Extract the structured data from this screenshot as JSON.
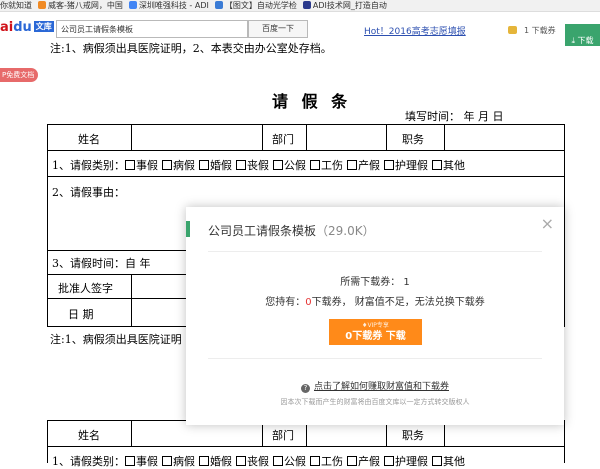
{
  "bookmarks": [
    {
      "label": "你就知道",
      "color": ""
    },
    {
      "label": "威客-猪八戒网，中国",
      "color": "#f08a24"
    },
    {
      "label": "深圳唯强科技 - ADI",
      "color": "#4285f4"
    },
    {
      "label": "【图文】自动光学检",
      "color": "#3a7bd5"
    },
    {
      "label": "ADI技术网_打造自动",
      "color": "#2b3a8c"
    }
  ],
  "toolbar": {
    "logo_main": "ai",
    "logo_paw": "du",
    "logo_badge": "文库",
    "search_value": "公司员工请假条模板",
    "search_button": "百度一下",
    "hot_link": "Hot！2016高考志愿填报",
    "coins": "1 下载券",
    "download": "下载"
  },
  "document": {
    "vip_tag": "P免费文档",
    "top_note": "注:1、病假须出具医院证明，2、本表交由办公室处存档。",
    "title": "请 假 条",
    "fill_time": "填写时间：          年    月    日",
    "name_label": "姓名",
    "dept_label": "部门",
    "post_label": "职务",
    "type_label": "1、请假类别：",
    "types": [
      "事假",
      "病假",
      "婚假",
      "丧假",
      "公假",
      "工伤",
      "产假",
      "护理假",
      "其他"
    ],
    "reason_label": "2、请假事由：",
    "time_label": "3、请假时间：自        年",
    "approver_label": "批准人签字",
    "date_label": "日    期",
    "bottom_note": "注:1、病假须出具医院证明",
    "name_label_2": "姓名",
    "dept_label_2": "部门",
    "post_label_2": "职务",
    "type_label_2": "1、请假类别：",
    "types_2": [
      "事假",
      "病假",
      "婚假",
      "丧假",
      "公假",
      "工伤",
      "产假",
      "护理假",
      "其他"
    ]
  },
  "modal": {
    "title": "公司员工请假条模板",
    "size": "（29.0K）",
    "need_text": "所需下载券：",
    "need_value": "1",
    "have_prefix": "您持有：",
    "have_value": "0",
    "have_suffix": "下载券， 财富值不足，无法兑换下载券",
    "vip_text": "VIP专享",
    "button_text": "0下载券 下载",
    "help_link": "点击了解如何赚取财富值和下载券",
    "note": "因本次下载而产生的财富将由百度文库以一定方式转交版权人",
    "close": "×"
  },
  "colors": {
    "green": "#3aa46d",
    "orange": "#ff8a19",
    "red": "#e53333",
    "link": "#2c4fb0"
  }
}
